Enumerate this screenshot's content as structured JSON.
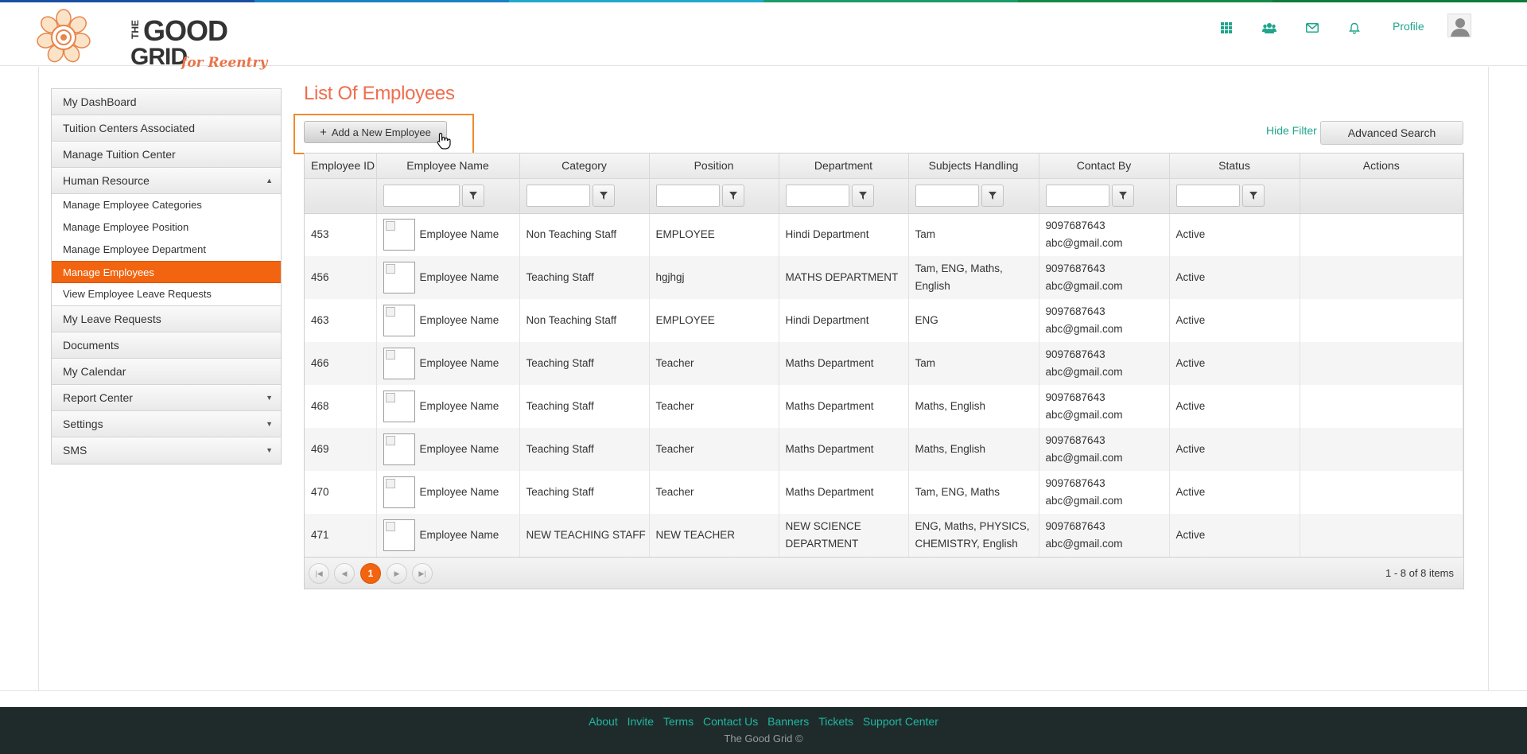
{
  "colors": {
    "accent": "#20a48c",
    "active": "#f2640f",
    "title": "#ef6e4d",
    "footer_bg": "#1f2b2b"
  },
  "header": {
    "logo": {
      "the": "THE",
      "good": "GOOD",
      "grid": "GRID",
      "tagline": "for Reentry"
    },
    "icons": [
      "apps-grid-icon",
      "users-icon",
      "mail-icon",
      "bell-icon"
    ],
    "profile_label": "Profile"
  },
  "sidebar": {
    "items": [
      {
        "label": "My DashBoard"
      },
      {
        "label": "Tuition Centers Associated"
      },
      {
        "label": "Manage Tuition Center"
      },
      {
        "label": "Human Resource",
        "caret": "▲"
      },
      {
        "label": "My Leave Requests"
      },
      {
        "label": "Documents"
      },
      {
        "label": "My Calendar"
      },
      {
        "label": "Report Center",
        "caret": "▼"
      },
      {
        "label": "Settings",
        "caret": "▼"
      },
      {
        "label": "SMS",
        "caret": "▼"
      }
    ],
    "human_resource_sub": [
      "Manage Employee Categories",
      "Manage Employee Position",
      "Manage Employee Department",
      "Manage Employees",
      "View Employee Leave Requests"
    ]
  },
  "main": {
    "title": "List Of Employees",
    "add_button": "Add a New Employee",
    "hide_filter": "Hide Filter",
    "advanced_search": "Advanced Search",
    "columns": [
      "Employee ID",
      "Employee Name",
      "Category",
      "Position",
      "Department",
      "Subjects Handling",
      "Contact By",
      "Status",
      "Actions"
    ],
    "rows": [
      {
        "id": "453",
        "name": "Employee Name",
        "category": "Non Teaching Staff",
        "position": "EMPLOYEE",
        "department": "Hindi Department",
        "subjects": "Tam",
        "phone": "9097687643",
        "email": "abc@gmail.com",
        "status": "Active"
      },
      {
        "id": "456",
        "name": "Employee Name",
        "category": "Teaching Staff",
        "position": "hgjhgj",
        "department": "MATHS DEPARTMENT",
        "subjects": "Tam, ENG, Maths, English",
        "phone": "9097687643",
        "email": "abc@gmail.com",
        "status": "Active"
      },
      {
        "id": "463",
        "name": "Employee Name",
        "category": "Non Teaching Staff",
        "position": "EMPLOYEE",
        "department": "Hindi Department",
        "subjects": "ENG",
        "phone": "9097687643",
        "email": "abc@gmail.com",
        "status": "Active"
      },
      {
        "id": "466",
        "name": "Employee Name",
        "category": "Teaching Staff",
        "position": "Teacher",
        "department": "Maths Department",
        "subjects": "Tam",
        "phone": "9097687643",
        "email": "abc@gmail.com",
        "status": "Active"
      },
      {
        "id": "468",
        "name": "Employee Name",
        "category": "Teaching Staff",
        "position": "Teacher",
        "department": "Maths Department",
        "subjects": "Maths, English",
        "phone": "9097687643",
        "email": "abc@gmail.com",
        "status": "Active"
      },
      {
        "id": "469",
        "name": "Employee Name",
        "category": "Teaching Staff",
        "position": "Teacher",
        "department": "Maths Department",
        "subjects": "Maths, English",
        "phone": "9097687643",
        "email": "abc@gmail.com",
        "status": "Active"
      },
      {
        "id": "470",
        "name": "Employee Name",
        "category": "Teaching Staff",
        "position": "Teacher",
        "department": "Maths Department",
        "subjects": "Tam, ENG, Maths",
        "phone": "9097687643",
        "email": "abc@gmail.com",
        "status": "Active"
      },
      {
        "id": "471",
        "name": "Employee Name",
        "category": "NEW TEACHING STAFF",
        "position": "NEW TEACHER",
        "department": "NEW SCIENCE DEPARTMENT",
        "subjects": "ENG, Maths, PHYSICS, CHEMISTRY, English",
        "phone": "9097687643",
        "email": "abc@gmail.com",
        "status": "Active"
      }
    ],
    "pager": {
      "current_page": "1",
      "info": "1 - 8 of 8 items"
    }
  },
  "footer": {
    "links": [
      "About",
      "Invite",
      "Terms",
      "Contact Us",
      "Banners",
      "Tickets",
      "Support Center"
    ],
    "copyright": "The Good Grid ©"
  }
}
